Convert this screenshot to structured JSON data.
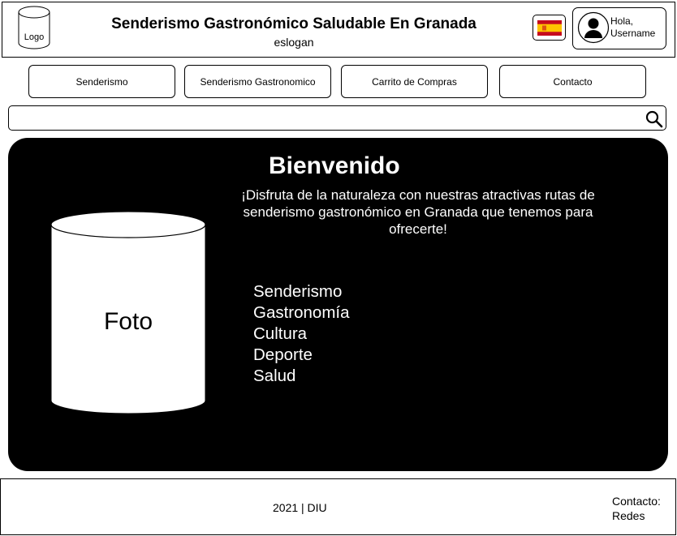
{
  "header": {
    "logo_label": "Logo",
    "title": "Senderismo Gastronómico Saludable En Granada",
    "slogan": "eslogan",
    "language_flag": "spain-flag-icon",
    "user": {
      "greeting": "Hola,",
      "name": "Username",
      "icon": "avatar-icon"
    }
  },
  "nav": {
    "items": [
      {
        "label": "Senderismo"
      },
      {
        "label": "Senderismo Gastronomico"
      },
      {
        "label": "Carrito de Compras"
      },
      {
        "label": "Contacto"
      }
    ]
  },
  "search": {
    "value": "",
    "placeholder": "",
    "icon": "search-icon"
  },
  "hero": {
    "title": "Bienvenido",
    "subtitle": "¡Disfruta de la naturaleza con nuestras atractivas rutas de senderismo gastronómico en Granada que tenemos para ofrecerte!",
    "photo_label": "Foto",
    "features": [
      "Senderismo",
      "Gastronomía",
      "Cultura",
      "Deporte",
      "Salud"
    ]
  },
  "footer": {
    "copyright": "2021 | DIU",
    "contact_label": "Contacto:",
    "contact_value": "Redes"
  },
  "colors": {
    "background": "#ffffff",
    "hero_background": "#000000",
    "text": "#000000",
    "hero_text": "#ffffff",
    "flag_red": "#c60b1e",
    "flag_yellow": "#ffc400"
  }
}
